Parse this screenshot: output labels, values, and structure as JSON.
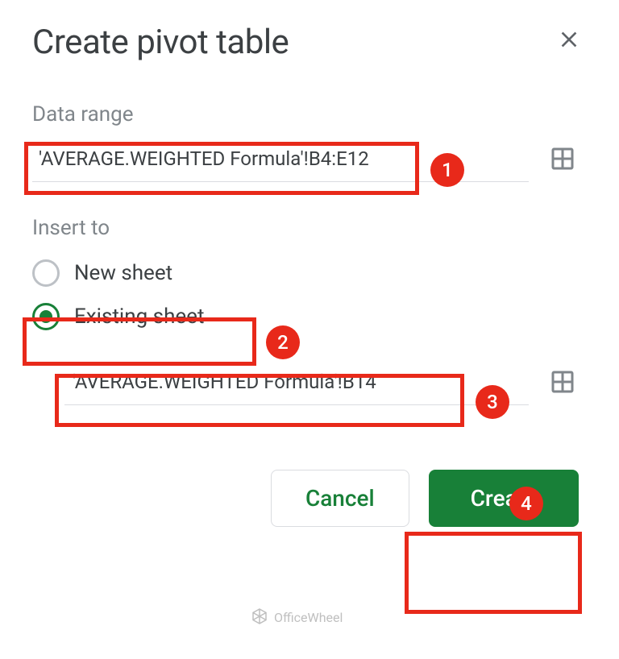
{
  "dialog": {
    "title": "Create pivot table"
  },
  "sections": {
    "data_range_label": "Data range",
    "insert_to_label": "Insert to"
  },
  "inputs": {
    "data_range": "'AVERAGE.WEIGHTED Formula'!B4:E12",
    "destination": "'AVERAGE.WEIGHTED Formula'!B14"
  },
  "radios": {
    "new_sheet": "New sheet",
    "existing_sheet": "Existing sheet",
    "selected": "existing_sheet"
  },
  "buttons": {
    "cancel": "Cancel",
    "create": "Create"
  },
  "annotations": {
    "b1": "1",
    "b2": "2",
    "b3": "3",
    "b4": "4"
  },
  "watermark": "OfficeWheel"
}
